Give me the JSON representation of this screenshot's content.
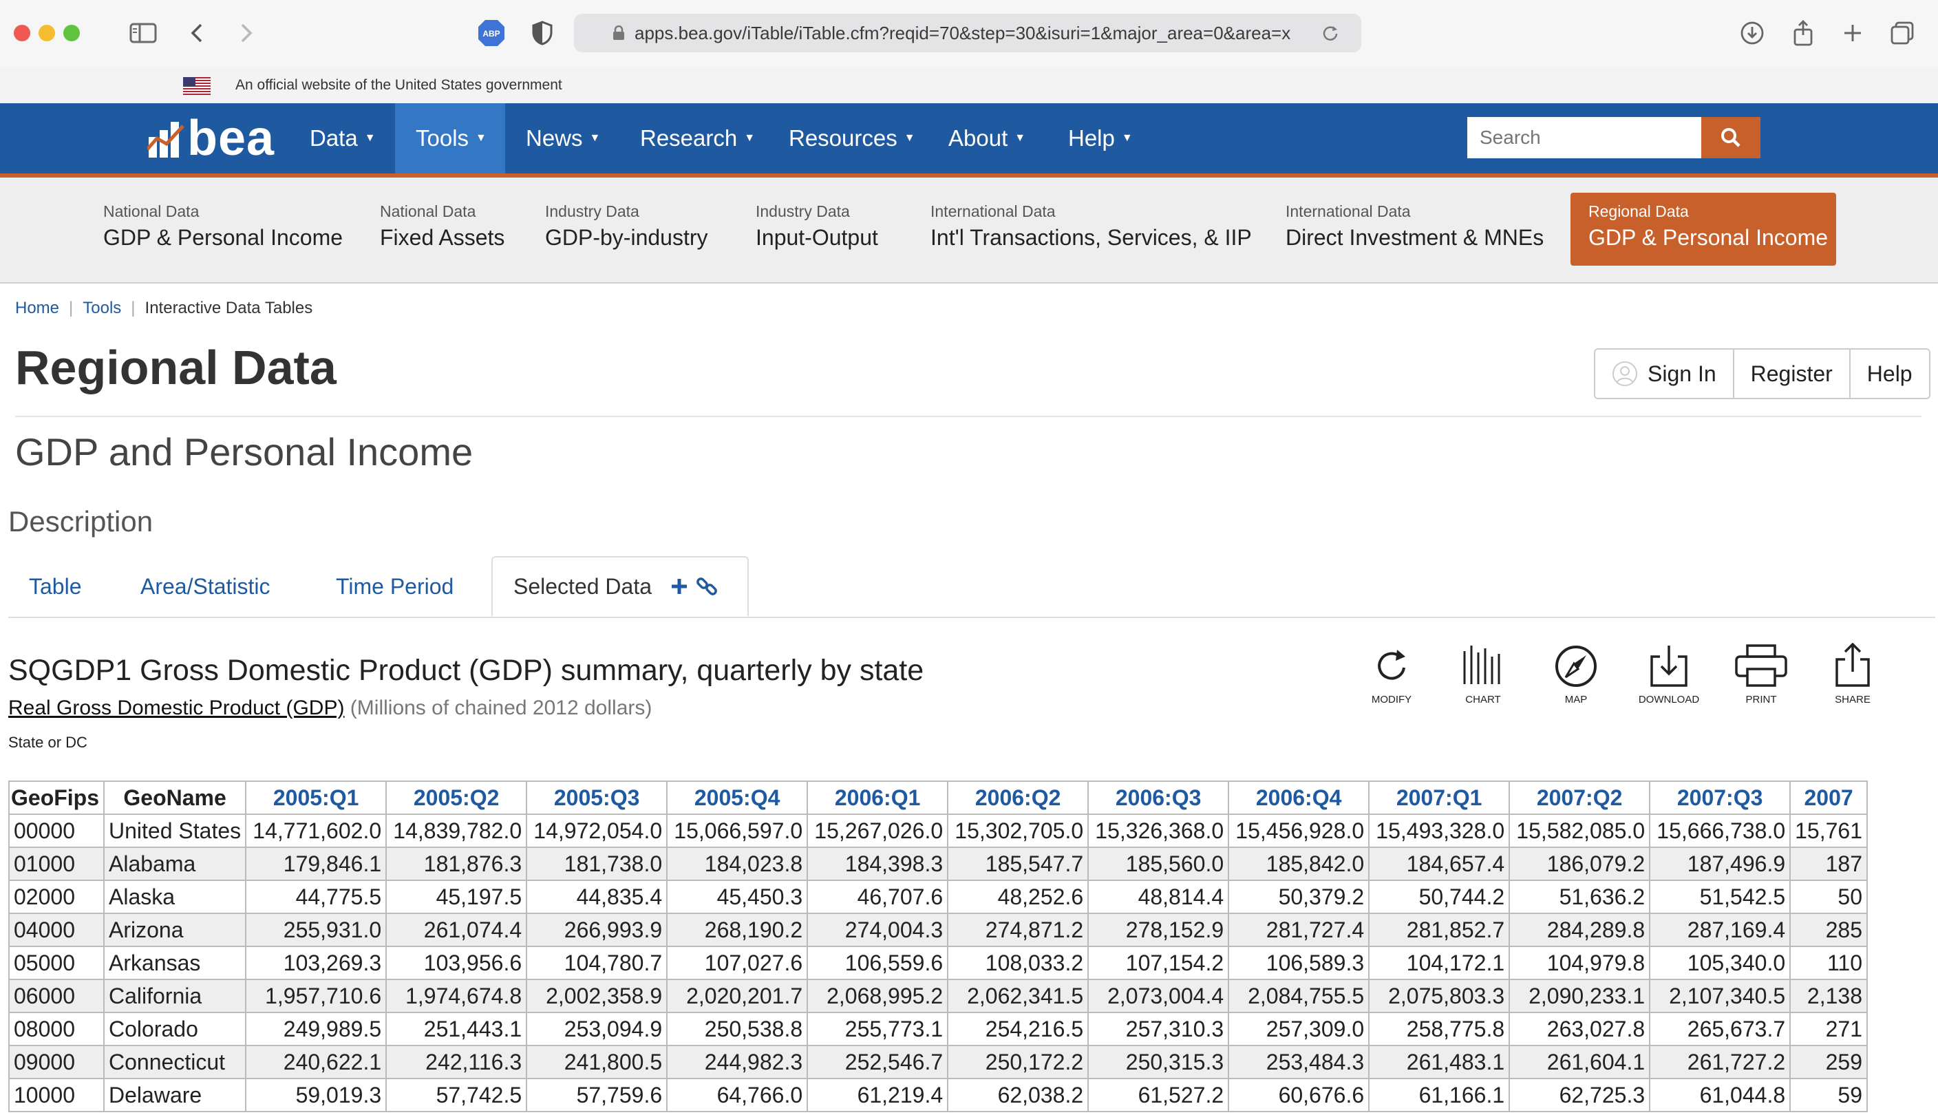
{
  "browser": {
    "url": "apps.bea.gov/iTable/iTable.cfm?reqid=70&step=30&isuri=1&major_area=0&area=x",
    "adblock_label": "ABP"
  },
  "gov_banner": {
    "text": "An official website of the United States government"
  },
  "nav": {
    "logo_text": "bea",
    "items": [
      {
        "label": "Data"
      },
      {
        "label": "Tools"
      },
      {
        "label": "News"
      },
      {
        "label": "Research"
      },
      {
        "label": "Resources"
      },
      {
        "label": "About"
      },
      {
        "label": "Help"
      }
    ],
    "search_placeholder": "Search"
  },
  "subnav": [
    {
      "small": "National Data",
      "big": "GDP & Personal Income"
    },
    {
      "small": "National Data",
      "big": "Fixed Assets"
    },
    {
      "small": "Industry Data",
      "big": "GDP-by-industry"
    },
    {
      "small": "Industry Data",
      "big": "Input-Output"
    },
    {
      "small": "International Data",
      "big": "Int'l Transactions, Services, & IIP"
    },
    {
      "small": "International Data",
      "big": "Direct Investment & MNEs"
    },
    {
      "small": "Regional Data",
      "big": "GDP & Personal Income"
    }
  ],
  "breadcrumb": {
    "home": "Home",
    "tools": "Tools",
    "current": "Interactive Data Tables"
  },
  "page": {
    "title": "Regional Data",
    "subtitle": "GDP and Personal Income",
    "description": "Description"
  },
  "auth": {
    "sign_in": "Sign In",
    "register": "Register",
    "help": "Help"
  },
  "tabs": {
    "table": "Table",
    "area": "Area/Statistic",
    "time": "Time Period",
    "selected": "Selected Data"
  },
  "table_section": {
    "title": "SQGDP1 Gross Domestic Product (GDP) summary, quarterly by state",
    "measure": "Real Gross Domestic Product (GDP)",
    "unit": "(Millions of chained 2012 dollars)",
    "state_label": "State or DC"
  },
  "tools": {
    "modify": "MODIFY",
    "chart": "CHART",
    "map": "MAP",
    "download": "DOWNLOAD",
    "print": "PRINT",
    "share": "SHARE"
  },
  "table": {
    "col_geofips": "GeoFips",
    "col_geoname": "GeoName",
    "periods": [
      "2005:Q1",
      "2005:Q2",
      "2005:Q3",
      "2005:Q4",
      "2006:Q1",
      "2006:Q2",
      "2006:Q3",
      "2006:Q4",
      "2007:Q1",
      "2007:Q2",
      "2007:Q3",
      "2007"
    ],
    "rows": [
      {
        "fips": "00000",
        "name": "United States",
        "values": [
          "14,771,602.0",
          "14,839,782.0",
          "14,972,054.0",
          "15,066,597.0",
          "15,267,026.0",
          "15,302,705.0",
          "15,326,368.0",
          "15,456,928.0",
          "15,493,328.0",
          "15,582,085.0",
          "15,666,738.0",
          "15,761"
        ]
      },
      {
        "fips": "01000",
        "name": "Alabama",
        "values": [
          "179,846.1",
          "181,876.3",
          "181,738.0",
          "184,023.8",
          "184,398.3",
          "185,547.7",
          "185,560.0",
          "185,842.0",
          "184,657.4",
          "186,079.2",
          "187,496.9",
          "187"
        ]
      },
      {
        "fips": "02000",
        "name": "Alaska",
        "values": [
          "44,775.5",
          "45,197.5",
          "44,835.4",
          "45,450.3",
          "46,707.6",
          "48,252.6",
          "48,814.4",
          "50,379.2",
          "50,744.2",
          "51,636.2",
          "51,542.5",
          "50"
        ]
      },
      {
        "fips": "04000",
        "name": "Arizona",
        "values": [
          "255,931.0",
          "261,074.4",
          "266,993.9",
          "268,190.2",
          "274,004.3",
          "274,871.2",
          "278,152.9",
          "281,727.4",
          "281,852.7",
          "284,289.8",
          "287,169.4",
          "285"
        ]
      },
      {
        "fips": "05000",
        "name": "Arkansas",
        "values": [
          "103,269.3",
          "103,956.6",
          "104,780.7",
          "107,027.6",
          "106,559.6",
          "108,033.2",
          "107,154.2",
          "106,589.3",
          "104,172.1",
          "104,979.8",
          "105,340.0",
          "110"
        ]
      },
      {
        "fips": "06000",
        "name": "California",
        "values": [
          "1,957,710.6",
          "1,974,674.8",
          "2,002,358.9",
          "2,020,201.7",
          "2,068,995.2",
          "2,062,341.5",
          "2,073,004.4",
          "2,084,755.5",
          "2,075,803.3",
          "2,090,233.1",
          "2,107,340.5",
          "2,138"
        ]
      },
      {
        "fips": "08000",
        "name": "Colorado",
        "values": [
          "249,989.5",
          "251,443.1",
          "253,094.9",
          "250,538.8",
          "255,773.1",
          "254,216.5",
          "257,310.3",
          "257,309.0",
          "258,775.8",
          "263,027.8",
          "265,673.7",
          "271"
        ]
      },
      {
        "fips": "09000",
        "name": "Connecticut",
        "values": [
          "240,622.1",
          "242,116.3",
          "241,800.5",
          "244,982.3",
          "252,546.7",
          "250,172.2",
          "250,315.3",
          "253,484.3",
          "261,483.1",
          "261,604.1",
          "261,727.2",
          "259"
        ]
      },
      {
        "fips": "10000",
        "name": "Delaware",
        "values": [
          "59,019.3",
          "57,742.5",
          "57,759.6",
          "64,766.0",
          "61,219.4",
          "62,038.2",
          "61,527.2",
          "60,676.6",
          "61,166.1",
          "62,725.3",
          "61,044.8",
          "59"
        ]
      }
    ]
  }
}
